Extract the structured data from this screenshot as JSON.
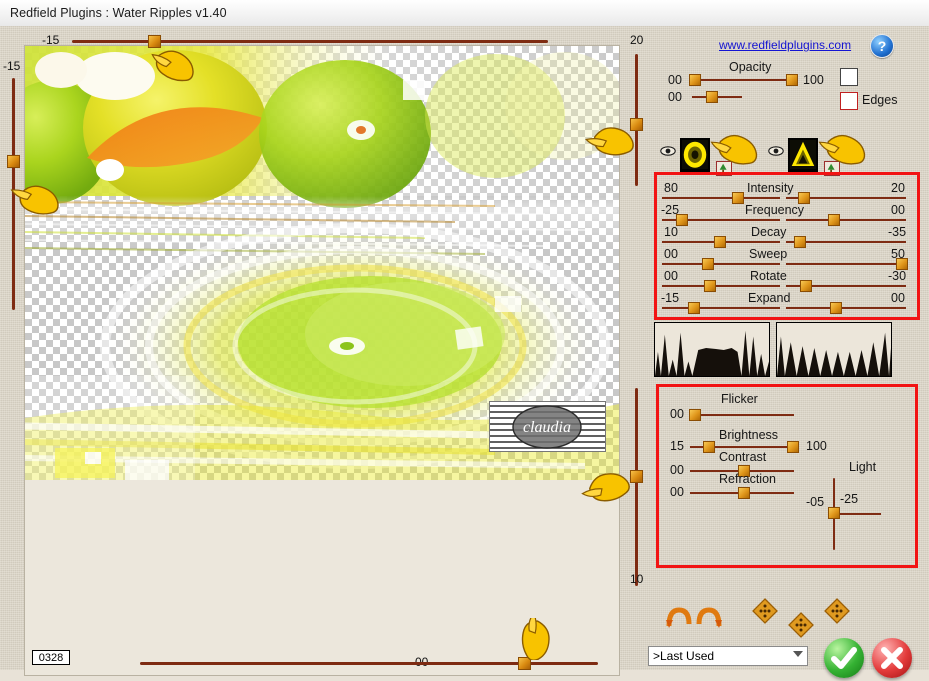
{
  "window": {
    "title": "Redfield Plugins : Water Ripples v1.40"
  },
  "header": {
    "link_text": "www.redfieldplugins.com",
    "help_label": "?"
  },
  "rulers": {
    "top_value": "-15",
    "left_value": "-15",
    "bottom_value": "00",
    "right_top_value": "20",
    "right_bottom_value": "10"
  },
  "status": {
    "value": "0328"
  },
  "watermark": {
    "text": "claudia"
  },
  "opacity": {
    "label": "Opacity",
    "left_value": "00",
    "right_value": "100",
    "second_value": "00",
    "edges_label": "Edges"
  },
  "main_sliders": [
    {
      "label": "Intensity",
      "left_value": "80",
      "right_value": "20"
    },
    {
      "label": "Frequency",
      "left_value": "-25",
      "right_value": "00"
    },
    {
      "label": "Decay",
      "left_value": "10",
      "right_value": "-35"
    },
    {
      "label": "Sweep",
      "left_value": "00",
      "right_value": "50"
    },
    {
      "label": "Rotate",
      "left_value": "00",
      "right_value": "-30"
    },
    {
      "label": "Expand",
      "left_value": "-15",
      "right_value": "00"
    }
  ],
  "light_panel": {
    "flicker": {
      "label": "Flicker",
      "value": "00"
    },
    "brightness": {
      "label": "Brightness",
      "left_value": "15",
      "right_value": "100"
    },
    "contrast": {
      "label": "Contrast",
      "value": "00"
    },
    "refraction": {
      "label": "Refraction",
      "value": "00"
    },
    "light": {
      "label": "Light",
      "x_value": "-05",
      "y_value": "-25"
    }
  },
  "footer": {
    "preset_value": ">Last Used",
    "ok_label": "✓",
    "cancel_label": "✕"
  },
  "colors": {
    "accent_red": "#f21414",
    "knob_gold": "#df951a",
    "track_brown": "#7e2b12",
    "link_blue": "#1414d2",
    "panel_bg": "#dcd5c7",
    "ok_green": "#35b233",
    "cancel_red": "#e33b3b"
  }
}
